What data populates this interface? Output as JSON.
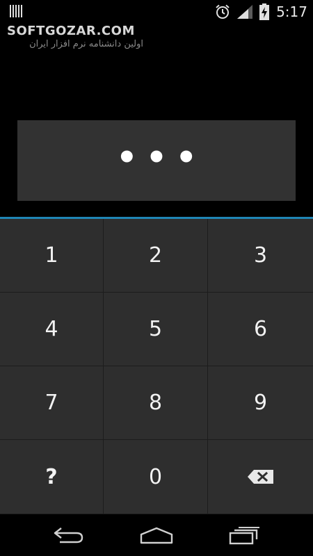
{
  "status_bar": {
    "left_icon": "barcode-icon",
    "icons": [
      "alarm-icon",
      "signal-icon",
      "battery-charging-icon"
    ],
    "time": "5:17"
  },
  "watermark": {
    "title": "SOFTGOZAR.COM",
    "subtitle": "اولین دانشنامه نرم افزار ایران"
  },
  "pin_display": {
    "masked_value": "•••"
  },
  "keypad": {
    "keys": [
      "1",
      "2",
      "3",
      "4",
      "5",
      "6",
      "7",
      "8",
      "9",
      "?",
      "0"
    ],
    "delete_icon": "backspace-icon"
  },
  "nav_bar": {
    "icons": [
      "back-icon",
      "home-icon",
      "recents-icon"
    ]
  },
  "colors": {
    "accent": "#1f86b6",
    "key_background": "#2e2e2e",
    "pin_box_background": "#323232"
  }
}
